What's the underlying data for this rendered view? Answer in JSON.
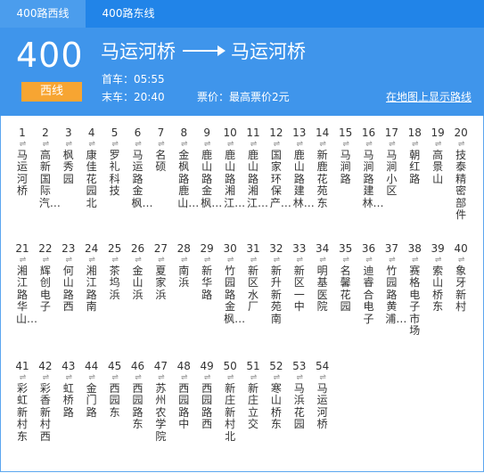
{
  "tabs": [
    {
      "label": "400路西线"
    },
    {
      "label": "400路东线"
    }
  ],
  "route": {
    "number": "400",
    "direction_badge": "西线",
    "from": "马运河桥",
    "to": "马运河桥",
    "first_bus": "首车：05:55",
    "last_bus": "末车：20:40",
    "fare": "票价：最高票价2元",
    "map_link": "在地图上显示路线"
  },
  "colors": {
    "tab_bar": "#2184e8",
    "header": "#3f95eb",
    "badge": "#f7a532",
    "border": "#5ba6ef"
  },
  "stops": [
    {
      "num": "1",
      "name": "马运河桥"
    },
    {
      "num": "2",
      "name": "高新国际汽…"
    },
    {
      "num": "3",
      "name": "枫秀园"
    },
    {
      "num": "4",
      "name": "康佳花园北"
    },
    {
      "num": "5",
      "name": "罗礼科技"
    },
    {
      "num": "6",
      "name": "马运路金枫…"
    },
    {
      "num": "7",
      "name": "名硕"
    },
    {
      "num": "8",
      "name": "金枫路鹿山…"
    },
    {
      "num": "9",
      "name": "鹿山路金枫…"
    },
    {
      "num": "10",
      "name": "鹿山路湘江…"
    },
    {
      "num": "11",
      "name": "鹿山路湘江…"
    },
    {
      "num": "12",
      "name": "国家环保产…"
    },
    {
      "num": "13",
      "name": "鹿山路建林…"
    },
    {
      "num": "14",
      "name": "新鹿花苑东"
    },
    {
      "num": "15",
      "name": "马涧路"
    },
    {
      "num": "16",
      "name": "马涧路建林…"
    },
    {
      "num": "17",
      "name": "马涧小区"
    },
    {
      "num": "18",
      "name": "朝红路"
    },
    {
      "num": "19",
      "name": "高景山"
    },
    {
      "num": "20",
      "name": "技泰精密部件"
    },
    {
      "num": "21",
      "name": "湘江路华山…"
    },
    {
      "num": "22",
      "name": "辉创电子"
    },
    {
      "num": "23",
      "name": "何山路西"
    },
    {
      "num": "24",
      "name": "湘江路南"
    },
    {
      "num": "25",
      "name": "茶坞浜"
    },
    {
      "num": "26",
      "name": "金山浜"
    },
    {
      "num": "27",
      "name": "夏家浜"
    },
    {
      "num": "28",
      "name": "南浜"
    },
    {
      "num": "29",
      "name": "新华路"
    },
    {
      "num": "30",
      "name": "竹园路金枫…"
    },
    {
      "num": "31",
      "name": "新区水厂"
    },
    {
      "num": "32",
      "name": "新升新苑南"
    },
    {
      "num": "33",
      "name": "新区一中"
    },
    {
      "num": "34",
      "name": "明基医院"
    },
    {
      "num": "35",
      "name": "名馨花园"
    },
    {
      "num": "36",
      "name": "迪睿合电子"
    },
    {
      "num": "37",
      "name": "竹园路黄浦…"
    },
    {
      "num": "38",
      "name": "赛格电子市场"
    },
    {
      "num": "39",
      "name": "索山桥东"
    },
    {
      "num": "40",
      "name": "象牙新村"
    },
    {
      "num": "41",
      "name": "彩虹新村东"
    },
    {
      "num": "42",
      "name": "彩香新村西"
    },
    {
      "num": "43",
      "name": "虹桥路"
    },
    {
      "num": "44",
      "name": "金门路"
    },
    {
      "num": "45",
      "name": "西园东"
    },
    {
      "num": "46",
      "name": "西园路东"
    },
    {
      "num": "47",
      "name": "苏州农学院"
    },
    {
      "num": "48",
      "name": "西园路中"
    },
    {
      "num": "49",
      "name": "西园路西"
    },
    {
      "num": "50",
      "name": "新庄新村北"
    },
    {
      "num": "51",
      "name": "新庄立交"
    },
    {
      "num": "52",
      "name": "寒山桥东"
    },
    {
      "num": "53",
      "name": "马浜花园"
    },
    {
      "num": "54",
      "name": "马运河桥"
    }
  ]
}
